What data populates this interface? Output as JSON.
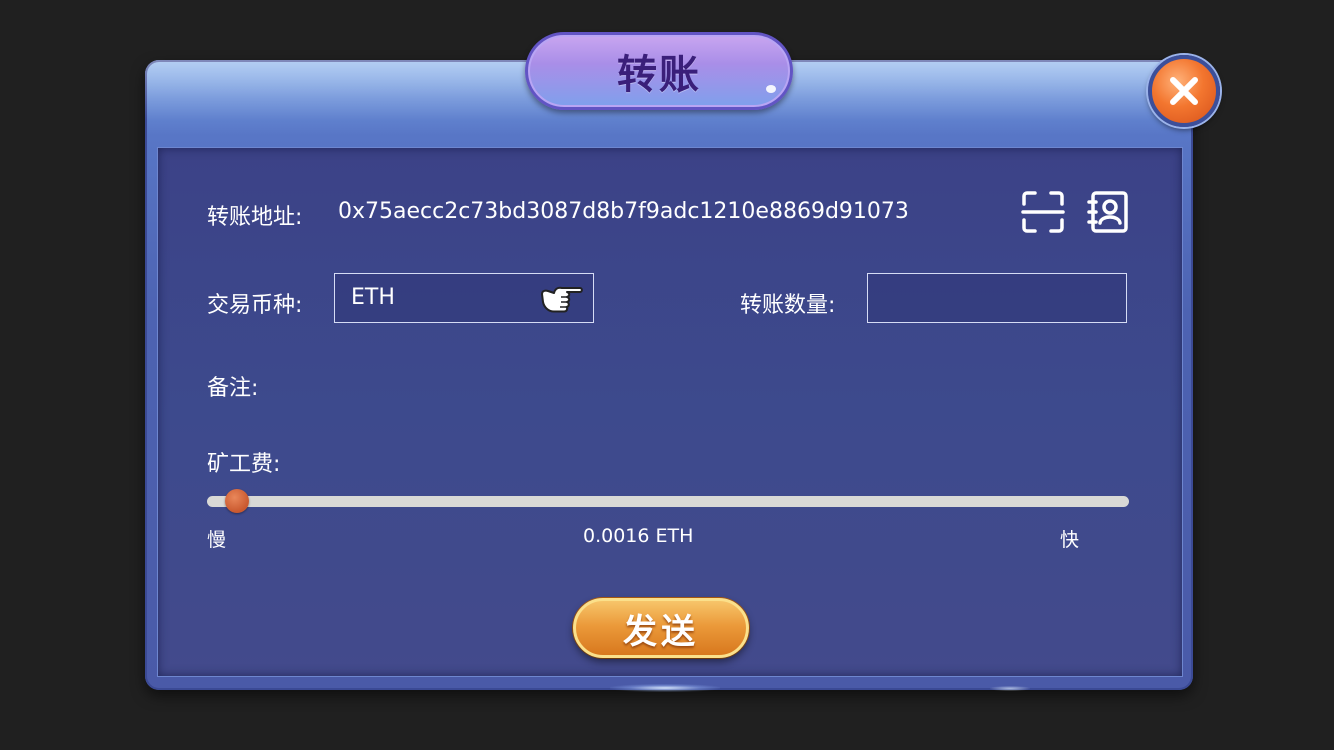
{
  "dialog": {
    "title": "转账",
    "close_icon": "close-icon"
  },
  "form": {
    "address_label": "转账地址:",
    "address_value": "0x75aecc2c73bd3087d8b7f9adc1210e8869d91073",
    "scan_icon": "scan-icon",
    "contacts_icon": "contacts-icon",
    "currency_label": "交易币种:",
    "currency_value": "ETH",
    "currency_selector_icon": "pointing-hand-icon",
    "amount_label": "转账数量:",
    "amount_value": "",
    "memo_label": "备注:",
    "fee_label": "矿工费:",
    "fee_slow_label": "慢",
    "fee_fast_label": "快",
    "fee_value": "0.0016 ETH",
    "fee_level": 0.02,
    "send_label": "发送"
  },
  "colors": {
    "panel": "#3d4a8d",
    "frame": "#5876c6",
    "title_text": "#3a1f7a",
    "close_button": "#f3762f",
    "send_button": "#eb9a3a",
    "slider_thumb": "#c9582e",
    "slider_track": "#d9d9d6"
  }
}
